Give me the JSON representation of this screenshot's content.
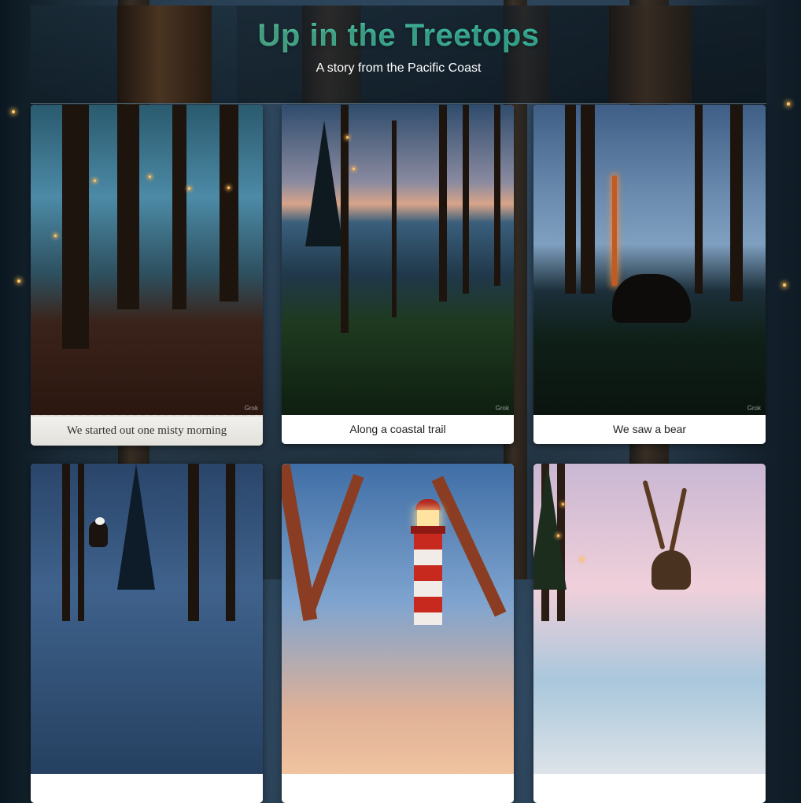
{
  "header": {
    "title": "Up in the Treetops",
    "subtitle": "A story from the Pacific Coast"
  },
  "colors": {
    "title_gradient_start": "#6fbf8e",
    "title_gradient_end": "#2fbfa8",
    "caption_text": "#222222",
    "card_bg": "#ffffff"
  },
  "cards": [
    {
      "caption": "We started out one misty morning",
      "watermark": "Grok",
      "image_icon": "misty-forest-lights-photo"
    },
    {
      "caption": "Along a coastal trail",
      "watermark": "Grok",
      "image_icon": "coastal-trail-photo"
    },
    {
      "caption": "We saw a bear",
      "watermark": "Grok",
      "image_icon": "bear-forest-photo"
    },
    {
      "caption": "",
      "watermark": "",
      "image_icon": "eagle-on-branch-photo"
    },
    {
      "caption": "",
      "watermark": "",
      "image_icon": "lighthouse-photo"
    },
    {
      "caption": "",
      "watermark": "",
      "image_icon": "deer-on-beach-photo"
    }
  ]
}
